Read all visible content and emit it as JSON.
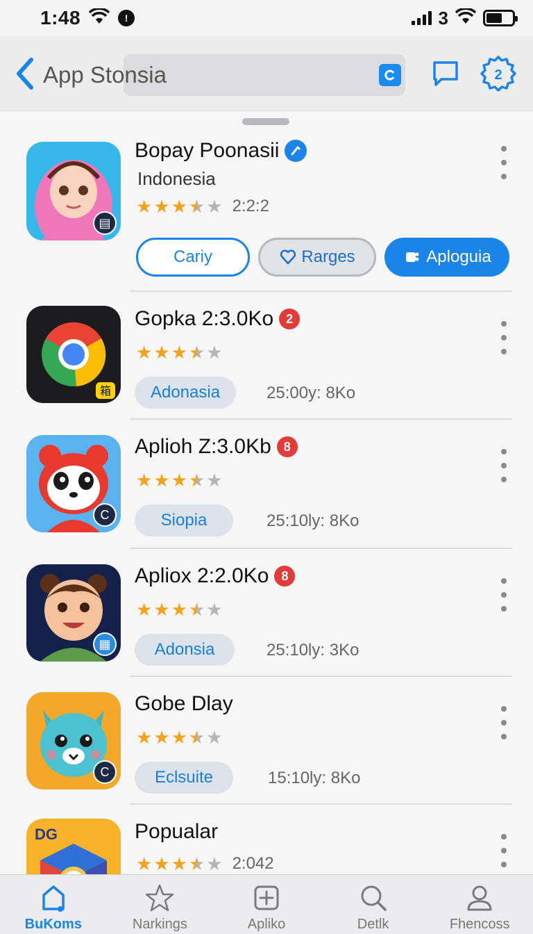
{
  "status_bar": {
    "time": "1:48",
    "carrier": "3"
  },
  "header": {
    "title": "App Stonsia"
  },
  "colors": {
    "accent": "#1a84e8",
    "star": "#f2a31b",
    "badge_red": "#e33a3a"
  },
  "apps": [
    {
      "name": "Bopay Poonasii",
      "subtitle": "Indonesia",
      "rating": 3.5,
      "score_text": "2:2:2",
      "icon": "hijab-girl-icon",
      "buttons": {
        "outline": "Cariy",
        "secondary": "Rarges",
        "primary": "Aploguia"
      }
    },
    {
      "name": "Gopka 2:3.0Ko",
      "badge": "2",
      "rating": 3.5,
      "tag": "Adonasia",
      "meta": "25:00y: 8Ko",
      "icon": "chrome-like-icon"
    },
    {
      "name": "Aplioh Z:3.0Kb",
      "badge": "8",
      "rating": 3.5,
      "tag": "Siopia",
      "meta": "25:10ly: 8Ko",
      "icon": "panda-icon"
    },
    {
      "name": "Apliox 2:2.0Ko",
      "badge": "8",
      "rating": 3.5,
      "tag": "Adonsia",
      "meta": "25:10ly: 3Ko",
      "icon": "boy-character-icon"
    },
    {
      "name": "Gobe Dlay",
      "rating": 3.5,
      "tag": "Eclsuite",
      "meta": "15:10ly: 8Ko",
      "icon": "cat-character-icon"
    },
    {
      "name": "Popualar",
      "rating": 3.5,
      "score_text": "2:042",
      "icon": "colorful-cube-icon",
      "icon_text": "DG"
    }
  ],
  "tabs": [
    {
      "label": "BuKoms",
      "icon": "home-icon",
      "active": true
    },
    {
      "label": "Narkings",
      "icon": "star-icon",
      "active": false
    },
    {
      "label": "Apliko",
      "icon": "plus-box-icon",
      "active": false
    },
    {
      "label": "Detlk",
      "icon": "search-icon",
      "active": false
    },
    {
      "label": "Fhencoss",
      "icon": "person-icon",
      "active": false
    }
  ]
}
